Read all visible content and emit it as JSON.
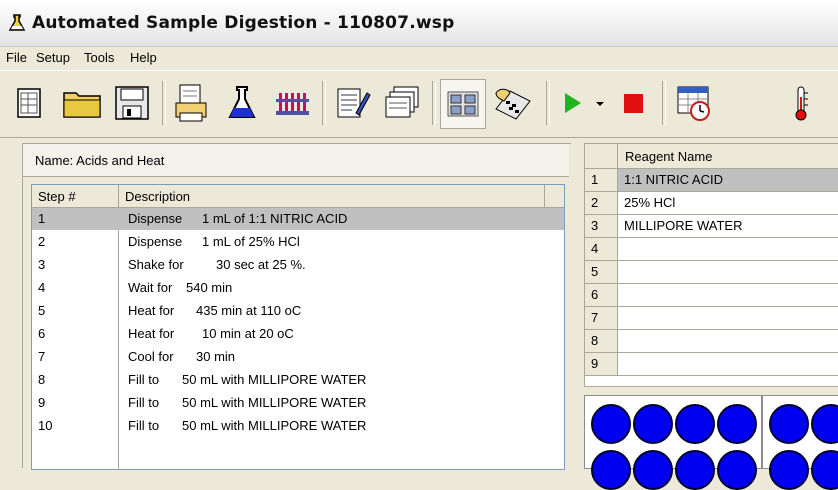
{
  "window": {
    "title": "Automated Sample Digestion - 110807.wsp",
    "icon": "flask-icon"
  },
  "menu": [
    "File",
    "Setup",
    "Tools",
    "Help"
  ],
  "toolbar": {
    "buttons": [
      "new-document-icon",
      "open-folder-icon",
      "save-disk-icon",
      "print-report-icon",
      "flask-icon",
      "test-tube-rack-icon",
      "edit-notes-icon",
      "stacked-cards-icon",
      "grid-view-icon",
      "hand-calculator-icon",
      "play-icon",
      "dropdown-arrow-icon",
      "stop-icon",
      "calendar-clock-icon",
      "thermometer-icon"
    ]
  },
  "method": {
    "name_label": "Name: Acids and Heat"
  },
  "steps_table": {
    "headers": [
      "Step #",
      "Description"
    ],
    "rows": [
      {
        "step": "1",
        "verb": "Dispense",
        "detail": "1 mL of 1:1 NITRIC ACID"
      },
      {
        "step": "2",
        "verb": "Dispense",
        "detail": "1 mL of 25% HCl"
      },
      {
        "step": "3",
        "verb": "Shake for",
        "detail": "30 sec at 25 %."
      },
      {
        "step": "4",
        "verb": "Wait for",
        "detail": "540 min"
      },
      {
        "step": "5",
        "verb": "Heat for",
        "detail": "435 min at 110 oC"
      },
      {
        "step": "6",
        "verb": "Heat for",
        "detail": "10 min at 20 oC"
      },
      {
        "step": "7",
        "verb": "Cool for",
        "detail": "30 min"
      },
      {
        "step": "8",
        "verb": "Fill to",
        "detail": "50 mL with MILLIPORE WATER"
      },
      {
        "step": "9",
        "verb": "Fill to",
        "detail": "50 mL with MILLIPORE WATER"
      },
      {
        "step": "10",
        "verb": "Fill to",
        "detail": "50 mL with MILLIPORE WATER"
      }
    ]
  },
  "reagents": {
    "header": "Reagent Name",
    "rows": [
      {
        "num": "1",
        "name": "1:1 NITRIC ACID"
      },
      {
        "num": "2",
        "name": "25% HCl"
      },
      {
        "num": "3",
        "name": "MILLIPORE WATER"
      },
      {
        "num": "4",
        "name": ""
      },
      {
        "num": "5",
        "name": ""
      },
      {
        "num": "6",
        "name": ""
      },
      {
        "num": "7",
        "name": ""
      },
      {
        "num": "8",
        "name": ""
      },
      {
        "num": "9",
        "name": ""
      }
    ]
  },
  "colors": {
    "well_blue": "#0000f0",
    "play_green": "#1db41d",
    "stop_red": "#e01010",
    "selection_gray": "#c0c0c0"
  }
}
